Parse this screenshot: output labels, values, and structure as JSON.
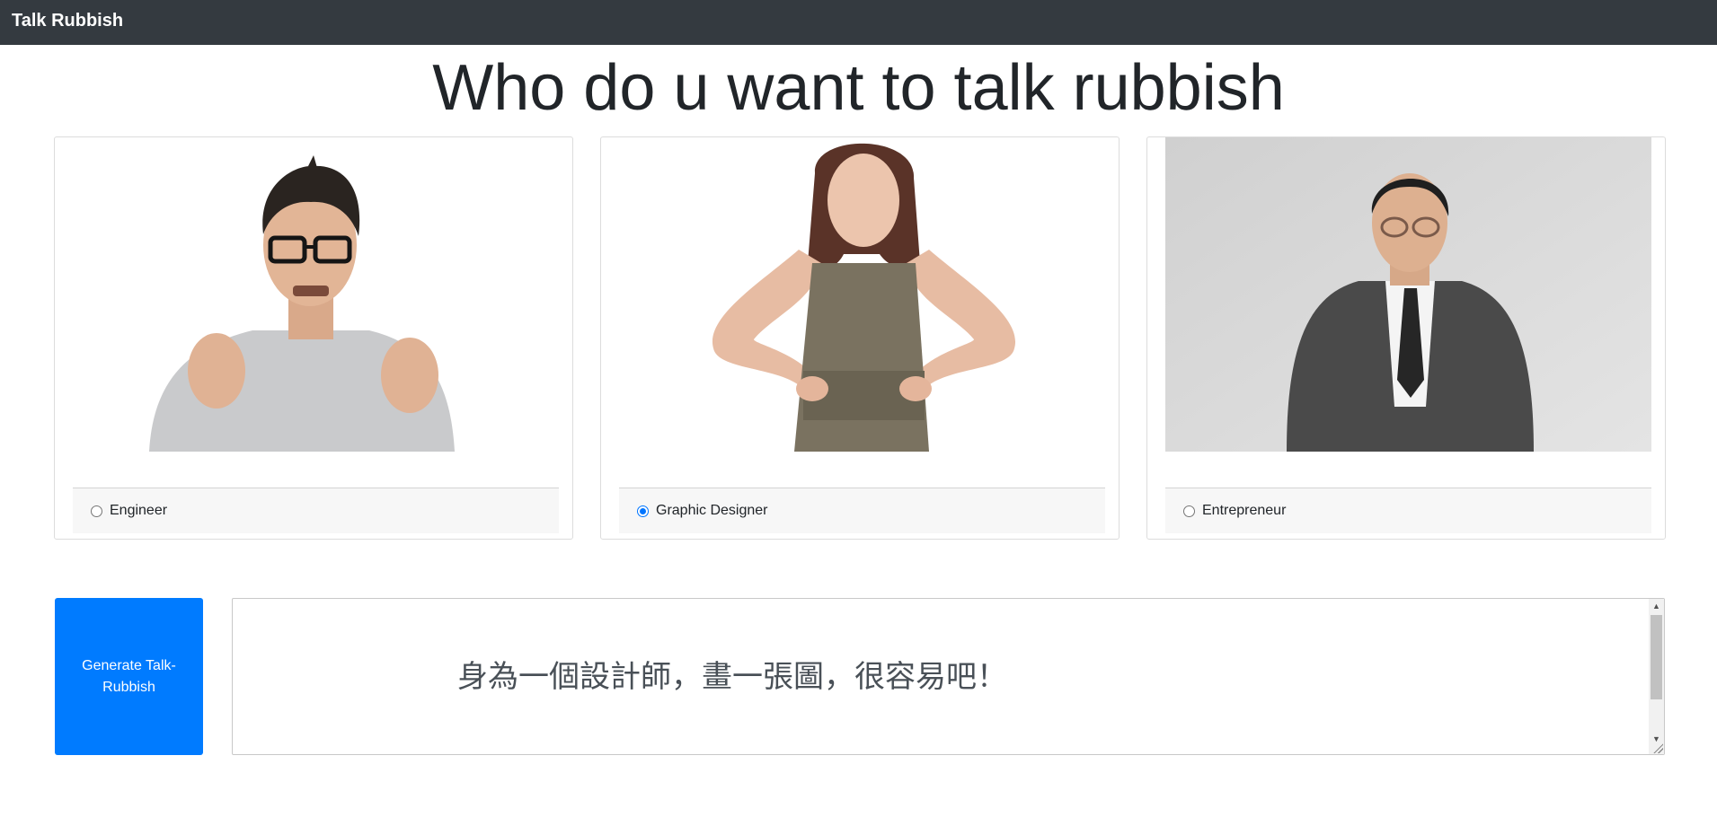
{
  "navbar": {
    "brand": "Talk Rubbish"
  },
  "heading": "Who do u want to talk rubbish",
  "options": [
    {
      "label": "Engineer",
      "checked": false
    },
    {
      "label": "Graphic Designer",
      "checked": true
    },
    {
      "label": "Entrepreneur",
      "checked": false
    }
  ],
  "button": {
    "label": "Generate Talk-Rubbish"
  },
  "output": {
    "text": "身為一個設計師，畫一張圖，很容易吧！"
  },
  "colors": {
    "navbar": "#343a40",
    "primary": "#007bff",
    "footer_bg": "#f7f7f7",
    "radio_checked": "#0075ff"
  }
}
